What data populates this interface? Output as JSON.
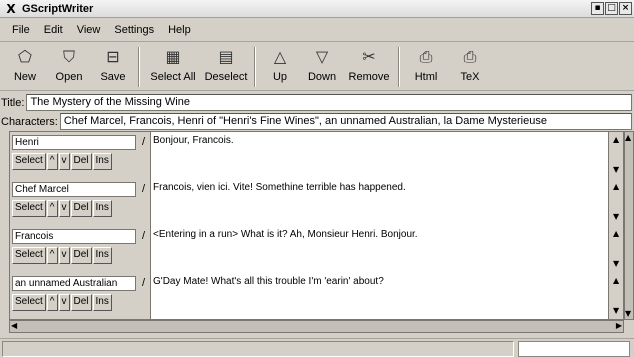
{
  "window": {
    "title": "GScriptWriter"
  },
  "menu": [
    "File",
    "Edit",
    "View",
    "Settings",
    "Help"
  ],
  "toolbar": [
    {
      "label": "New",
      "icon": "new-icon"
    },
    {
      "label": "Open",
      "icon": "open-icon"
    },
    {
      "label": "Save",
      "icon": "save-icon"
    },
    {
      "label": "Select All",
      "icon": "select-all-icon"
    },
    {
      "label": "Deselect",
      "icon": "deselect-icon"
    },
    {
      "label": "Up",
      "icon": "up-arrow-icon"
    },
    {
      "label": "Down",
      "icon": "down-arrow-icon"
    },
    {
      "label": "Remove",
      "icon": "scissors-icon"
    },
    {
      "label": "Html",
      "icon": "printer-icon"
    },
    {
      "label": "TeX",
      "icon": "printer-icon"
    }
  ],
  "fields": {
    "title_label": "Title:",
    "title_value": "The Mystery of the Missing Wine",
    "characters_label": "Characters:",
    "characters_value": "Chef Marcel, Francois, Henri of \"Henri's Fine Wines\", an unnamed Australian, la Dame Mysterieuse"
  },
  "row_buttons": {
    "select": "Select",
    "up": "^",
    "down": "v",
    "del": "Del",
    "ins": "Ins"
  },
  "lines": [
    {
      "character": "Henri",
      "text": "Bonjour, Francois."
    },
    {
      "character": "Chef Marcel",
      "text": "Francois, vien ici.  Vite!  Somethine terrible has happened."
    },
    {
      "character": "Francois",
      "text": "<Entering in a run>  What is it?  Ah, Monsieur Henri.  Bonjour."
    },
    {
      "character": "an unnamed Australian",
      "text": "G'Day Mate!  What's all this trouble I'm 'earin' about?"
    }
  ]
}
